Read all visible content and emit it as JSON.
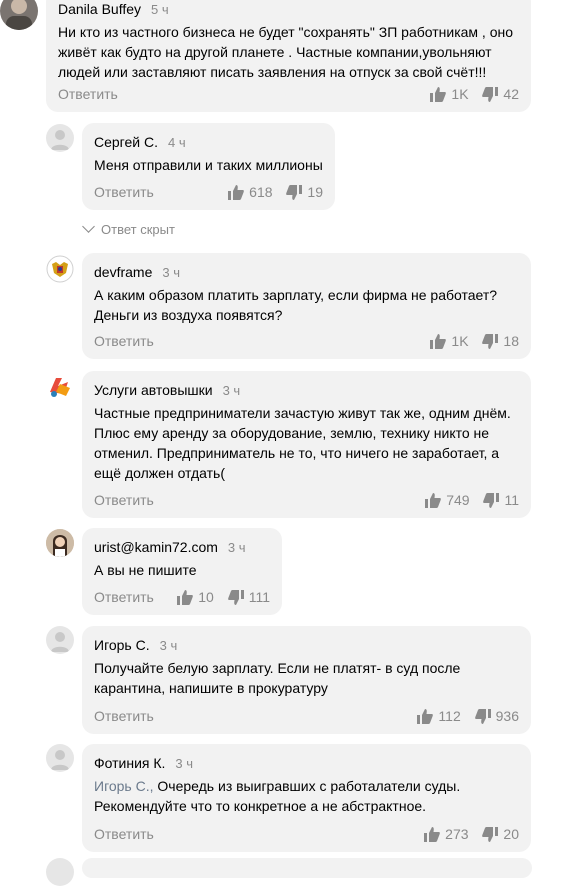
{
  "colors": {
    "bubble": "#f2f2f2",
    "muted": "#8a8a8a",
    "mention": "#6b7a8c"
  },
  "reply_label": "Ответить",
  "hidden_reply_label": "Ответ скрыт",
  "comments": [
    {
      "author": "Danila Buffey",
      "time": "5 ч",
      "text": "Ни кто из частного бизнеса не будет \"сохранять\" ЗП работникам , оно живёт как будто на другой планете . Частные компании,увольняют людей или заставляют писать заявления на отпуск за свой счёт!!!",
      "likes": "1K",
      "dislikes": "42",
      "avatar": "photo"
    },
    {
      "author": "Сергей С.",
      "time": "4 ч",
      "text": "Меня отправили и таких миллионы",
      "likes": "618",
      "dislikes": "19",
      "avatar": "default"
    },
    {
      "author": "devframe",
      "time": "3 ч",
      "text": "А каким образом платить зарплату, если фирма не работает? Деньги из воздуха появятся?",
      "likes": "1K",
      "dislikes": "18",
      "avatar": "emblem"
    },
    {
      "author": "Услуги автовышки",
      "time": "3 ч",
      "text": "Частные предприниматели зачастую живут так же, одним днём. Плюс ему аренду за оборудование, землю, технику никто не отменил. Предприниматель не то, что ничего не заработает, а ещё должен отдать(",
      "likes": "749",
      "dislikes": "11",
      "avatar": "logo"
    },
    {
      "author": "urist@kamin72.com",
      "time": "3 ч",
      "text": "А вы не пишите",
      "likes": "10",
      "dislikes": "111",
      "avatar": "photo-woman"
    },
    {
      "author": "Игорь С.",
      "time": "3 ч",
      "text": "Получайте белую зарплату. Если не платят- в суд после карантина, напишите в прокуратуру",
      "likes": "112",
      "dislikes": "936",
      "avatar": "default"
    },
    {
      "author": "Фотиния К.",
      "time": "3 ч",
      "mention": "Игорь С.,",
      "text": "Очередь из выигравших с работалатели суды. Рекомендуйте что то конкретное а не абстрактное.",
      "likes": "273",
      "dislikes": "20",
      "avatar": "default"
    }
  ]
}
